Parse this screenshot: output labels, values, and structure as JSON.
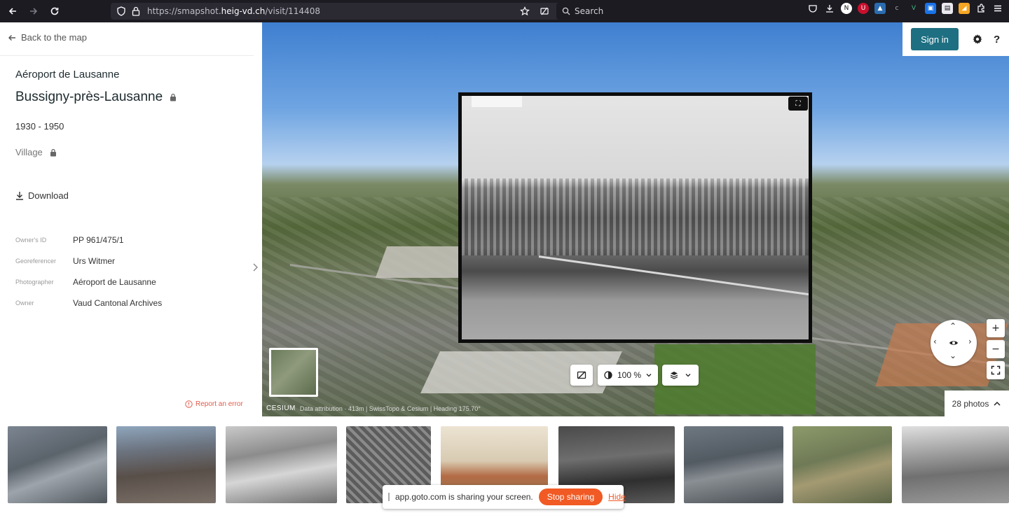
{
  "browser": {
    "url_prefix": "https://smapshot.",
    "url_domain": "heig-vd.ch",
    "url_path": "/visit/114408",
    "search_placeholder": "Search"
  },
  "left_panel": {
    "back_label": "Back to the map",
    "subtitle": "Aéroport de Lausanne",
    "title": "Bussigny-près-Lausanne",
    "date_range": "1930 - 1950",
    "type_label": "Village",
    "download_label": "Download",
    "metadata": [
      {
        "key": "Owner's ID",
        "value": "PP 961/475/1"
      },
      {
        "key": "Georeferencer",
        "value": "Urs Witmer"
      },
      {
        "key": "Photographer",
        "value": "Aéroport de Lausanne"
      },
      {
        "key": "Owner",
        "value": "Vaud Cantonal Archives"
      }
    ],
    "report_label": "Report an error"
  },
  "map": {
    "opacity_value": "100 %",
    "cesium_label": "CESIUM",
    "credit_text": "Data attribution · 413m | SwissTopo & Cesium | Heading 175.70°",
    "photos_count_label": "28 photos",
    "signin_label": "Sign in",
    "help_label": "?",
    "zoom_in_label": "+",
    "zoom_out_label": "−"
  },
  "share_banner": {
    "text": "app.goto.com is sharing your screen.",
    "stop_label": "Stop sharing",
    "hide_label": "Hide"
  },
  "filmstrip": {
    "thumb_count": 9
  },
  "colors": {
    "accent": "#1e6f82",
    "report": "#e05b4a",
    "stop_sharing": "#f15a24"
  }
}
